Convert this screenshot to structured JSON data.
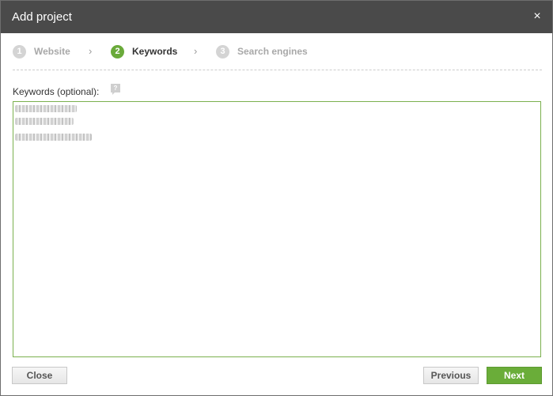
{
  "dialog": {
    "title": "Add project",
    "close_glyph": "×"
  },
  "steps": [
    {
      "number": "1",
      "label": "Website",
      "state": "inactive"
    },
    {
      "number": "2",
      "label": "Keywords",
      "state": "active"
    },
    {
      "number": "3",
      "label": "Search engines",
      "state": "inactive"
    }
  ],
  "step_separator": "›",
  "keywords": {
    "label": "Keywords (optional):",
    "help_glyph": "?",
    "value_redacted_lines": 3
  },
  "buttons": {
    "close": "Close",
    "previous": "Previous",
    "next": "Next"
  },
  "colors": {
    "titlebar": "#4a4a4a",
    "accent_green": "#6aad39",
    "inactive_step": "#d4d4d4"
  },
  "icons": {
    "close": "close-icon",
    "help": "help-icon",
    "separator": "chevron-right-icon"
  }
}
